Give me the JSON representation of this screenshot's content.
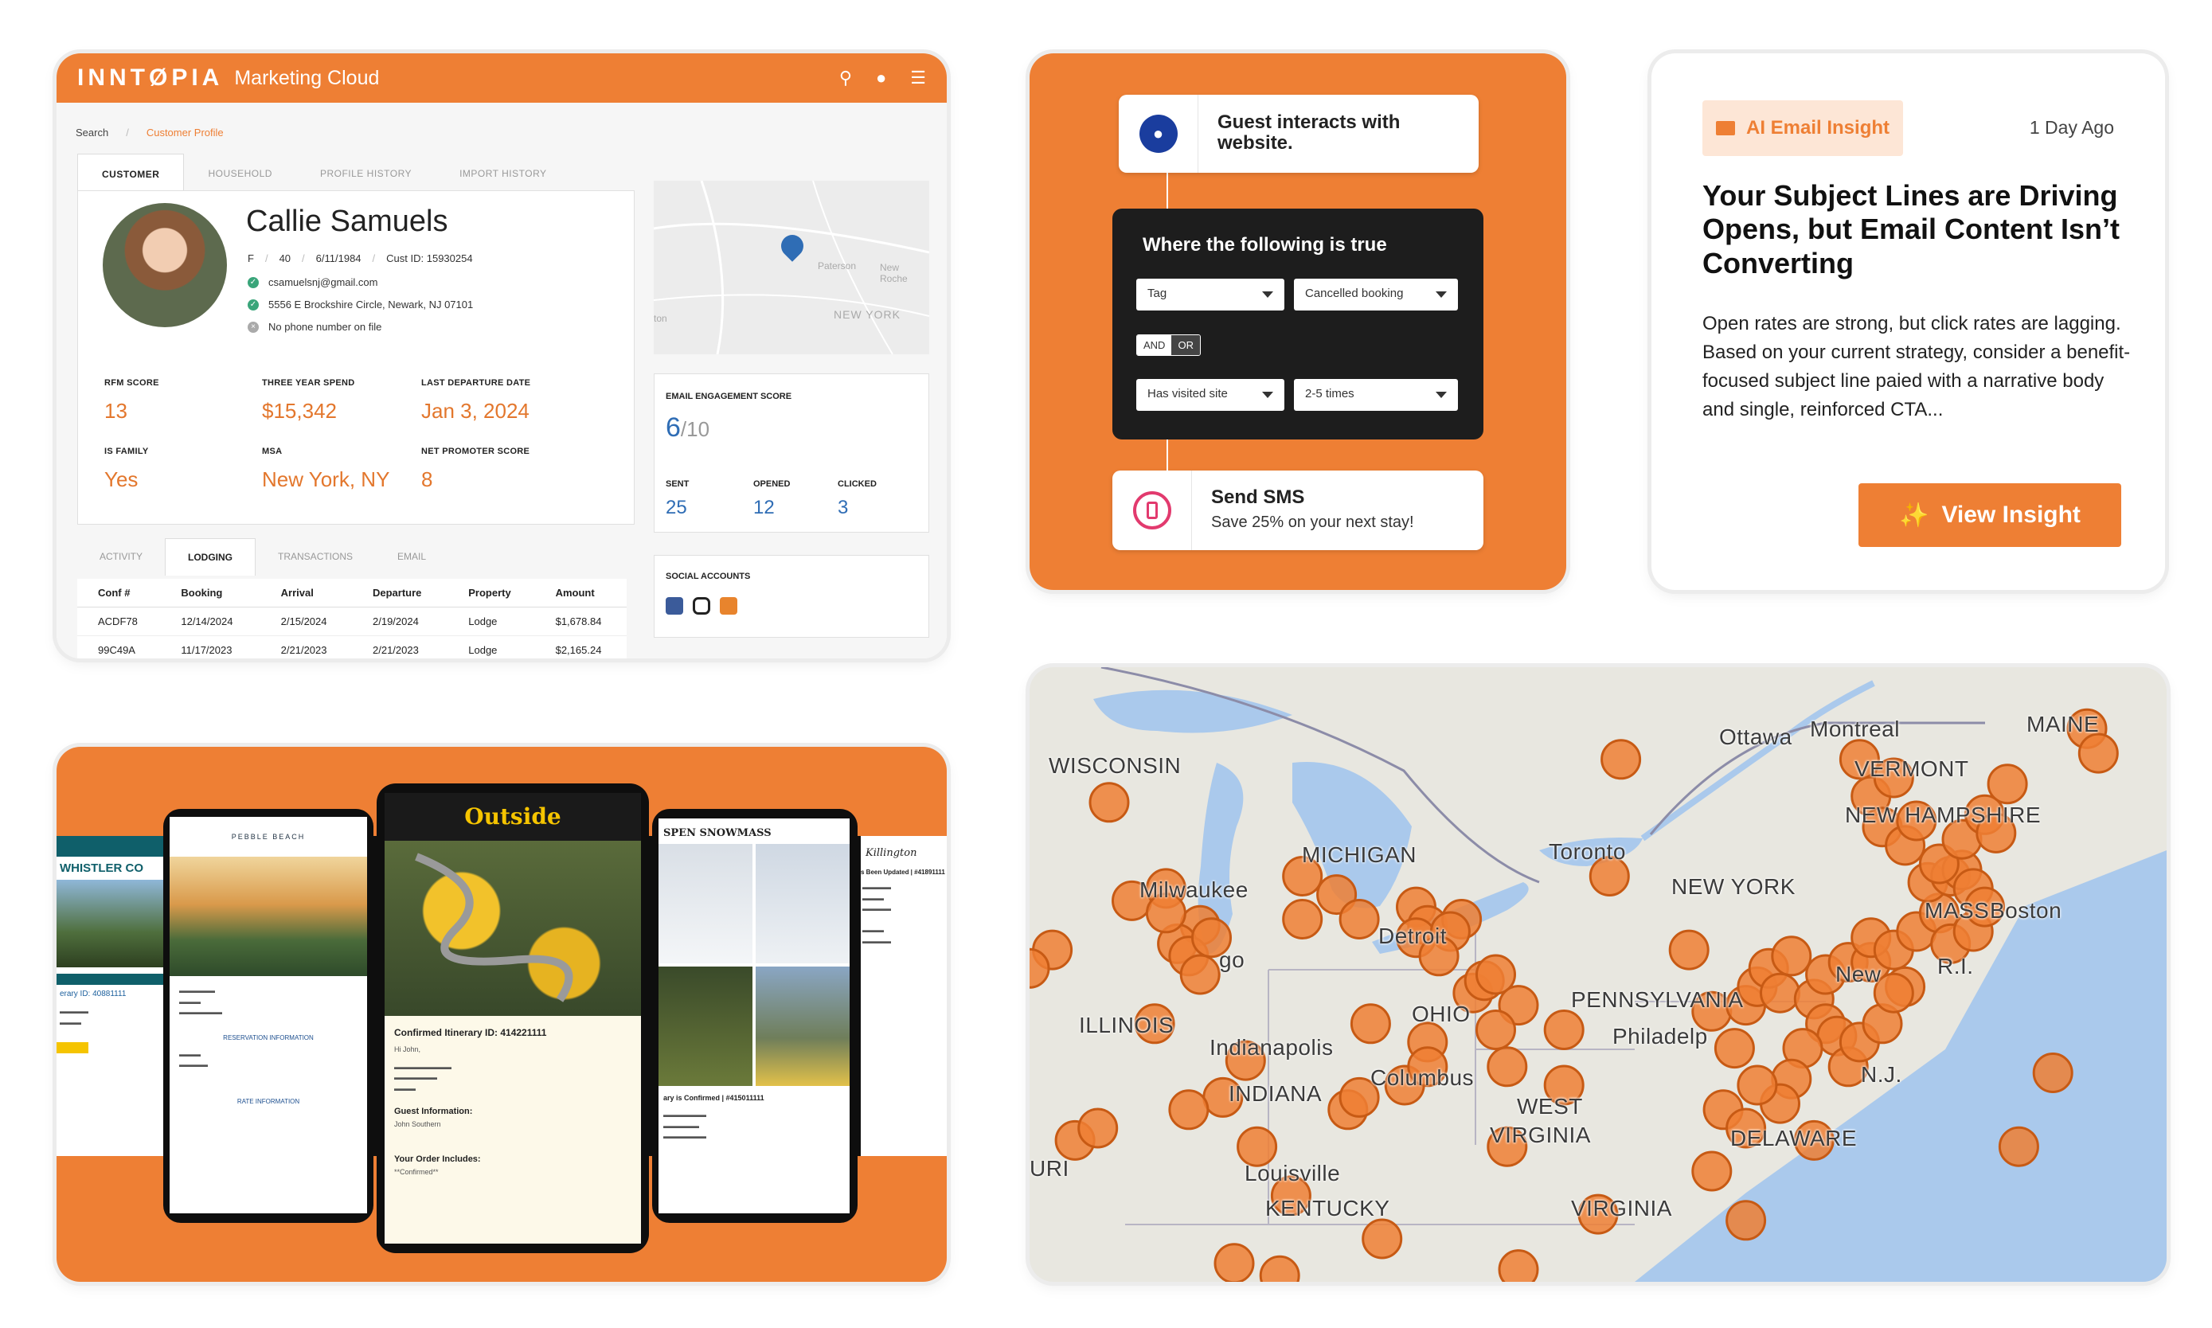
{
  "crm": {
    "brand": "INNTØPIA",
    "app_name": "Marketing Cloud",
    "icons": [
      "search-icon",
      "user-icon",
      "menu-icon"
    ],
    "breadcrumb": [
      "Search",
      "Customer Profile"
    ],
    "tabs": [
      "CUSTOMER",
      "HOUSEHOLD",
      "PROFILE HISTORY",
      "IMPORT HISTORY"
    ],
    "customer": {
      "name": "Callie Samuels",
      "gender": "F",
      "age": "40",
      "dob": "6/11/1984",
      "cust_id": "Cust ID: 15930254",
      "email": "csamuelsnj@gmail.com",
      "address": "5556 E Brockshire Circle, Newark, NJ 07101",
      "phone": "No phone number on file"
    },
    "stats": [
      {
        "label": "RFM SCORE",
        "value": "13"
      },
      {
        "label": "THREE YEAR SPEND",
        "value": "$15,342"
      },
      {
        "label": "LAST DEPARTURE DATE",
        "value": "Jan 3, 2024"
      },
      {
        "label": "IS FAMILY",
        "value": "Yes"
      },
      {
        "label": "MSA",
        "value": "New York, NY"
      },
      {
        "label": "NET PROMOTER SCORE",
        "value": "8"
      }
    ],
    "map_labels": [
      "Paterson",
      "New Roche",
      "NEW YORK",
      "ton"
    ],
    "engagement": {
      "label": "EMAIL ENGAGEMENT SCORE",
      "score": "6",
      "out_of": "/10",
      "sent_label": "SENT",
      "sent": "25",
      "opened_label": "OPENED",
      "opened": "12",
      "clicked_label": "CLICKED",
      "clicked": "3"
    },
    "social_label": "SOCIAL ACCOUNTS",
    "social_icons": [
      "facebook-icon",
      "instagram-icon",
      "youtube-icon"
    ],
    "bottom_tabs": [
      "ACTIVITY",
      "LODGING",
      "TRANSACTIONS",
      "EMAIL"
    ],
    "table": {
      "headers": [
        "Conf #",
        "Booking",
        "Arrival",
        "Departure",
        "Property",
        "Amount"
      ],
      "rows": [
        [
          "ACDF78",
          "12/14/2024",
          "2/15/2024",
          "2/19/2024",
          "Lodge",
          "$1,678.84"
        ],
        [
          "99C49A",
          "11/17/2023",
          "2/21/2023",
          "2/21/2023",
          "Lodge",
          "$2,165.24"
        ]
      ]
    }
  },
  "flow": {
    "trigger": "Guest interacts with website.",
    "condition_title": "Where the following is true",
    "row1": [
      "Tag",
      "Cancelled booking"
    ],
    "logic": [
      "AND",
      "OR"
    ],
    "row2": [
      "Has visited site",
      "2-5 times"
    ],
    "action_title": "Send SMS",
    "action_sub": "Save 25% on your next stay!",
    "colors": {
      "accent": "#ee7f34",
      "dark": "#1d1d1d",
      "user_icon_bg": "#1a3d9e",
      "sms_icon_bg": "#e23a6e"
    }
  },
  "insight": {
    "chip": "AI Email Insight",
    "ago": "1 Day Ago",
    "headline": "Your Subject Lines are Driving Opens, but Email Content Isn’t Converting",
    "body": "Open rates are strong, but click rates are lagging. Based on your current strategy, consider a benefit-focused subject line paied with a narrative body and single, reinforced CTA...",
    "button": "View Insight",
    "button_icon": "sparkle-icon",
    "chip_icon": "envelope-icon"
  },
  "emails": {
    "whistler": {
      "brand": "WHISTLER CO",
      "itinerary": "erary ID: 40881111"
    },
    "pebble": {
      "brand": "PEBBLE BEACH",
      "section1": "RESERVATION INFORMATION",
      "section2": "RATE INFORMATION"
    },
    "outside": {
      "brand": "Outside",
      "title": "Confirmed Itinerary ID: 414221111",
      "greeting": "Hi John,",
      "guest_label": "Guest Information:",
      "guest_name": "John Southern",
      "order_label": "Your Order Includes:",
      "order_line": "**Confirmed**"
    },
    "aspen": {
      "brand": "SPEN SNOWMASS",
      "confirm": "ary is Confirmed | #415011111"
    },
    "killington": {
      "brand": "Killington",
      "updated": "s Been Updated | #41891111"
    }
  },
  "map": {
    "labels": [
      "WISCONSIN",
      "MICHIGAN",
      "Milwaukee",
      "go",
      "ILLINOIS",
      "Indianapolis",
      "INDIANA",
      "OHIO",
      "Columbus",
      "Detroit",
      "Toronto",
      "Ottawa",
      "Montreal",
      "MAINE",
      "VERMONT",
      "NEW HAMPSHIRE",
      "NEW YORK",
      "MASS",
      "Boston",
      "New",
      "PENNSYLVANIA",
      "Philadelp",
      "N.J.",
      "R.I.",
      "DELAWARE",
      "WEST",
      "VIRGINIA",
      "Louisville",
      "KENTUCKY",
      "VIRGINIA",
      "URI"
    ],
    "marker_color": "#ee7f34",
    "points": [
      [
        0.07,
        0.22
      ],
      [
        0.09,
        0.38
      ],
      [
        0.12,
        0.36
      ],
      [
        0.15,
        0.42
      ],
      [
        0.13,
        0.45
      ],
      [
        0.14,
        0.47
      ],
      [
        0.16,
        0.44
      ],
      [
        0.15,
        0.5
      ],
      [
        0.12,
        0.4
      ],
      [
        0.11,
        0.58
      ],
      [
        0.02,
        0.46
      ],
      [
        0.0,
        0.49
      ],
      [
        0.19,
        0.64
      ],
      [
        0.17,
        0.7
      ],
      [
        0.14,
        0.72
      ],
      [
        0.2,
        0.78
      ],
      [
        0.04,
        0.77
      ],
      [
        0.06,
        0.75
      ],
      [
        0.24,
        0.34
      ],
      [
        0.27,
        0.37
      ],
      [
        0.24,
        0.41
      ],
      [
        0.29,
        0.41
      ],
      [
        0.3,
        0.58
      ],
      [
        0.33,
        0.68
      ],
      [
        0.28,
        0.72
      ],
      [
        0.29,
        0.7
      ],
      [
        0.23,
        0.86
      ],
      [
        0.18,
        0.97
      ],
      [
        0.22,
        0.99
      ],
      [
        0.31,
        0.93
      ],
      [
        0.34,
        0.39
      ],
      [
        0.35,
        0.42
      ],
      [
        0.34,
        0.44
      ],
      [
        0.38,
        0.41
      ],
      [
        0.37,
        0.43
      ],
      [
        0.36,
        0.47
      ],
      [
        0.39,
        0.53
      ],
      [
        0.4,
        0.51
      ],
      [
        0.41,
        0.5
      ],
      [
        0.43,
        0.55
      ],
      [
        0.41,
        0.59
      ],
      [
        0.35,
        0.61
      ],
      [
        0.35,
        0.65
      ],
      [
        0.42,
        0.65
      ],
      [
        0.47,
        0.59
      ],
      [
        0.47,
        0.68
      ],
      [
        0.42,
        0.78
      ],
      [
        0.5,
        0.89
      ],
      [
        0.43,
        0.98
      ],
      [
        0.51,
        0.34
      ],
      [
        0.52,
        0.15
      ],
      [
        0.58,
        0.46
      ],
      [
        0.6,
        0.56
      ],
      [
        0.62,
        0.62
      ],
      [
        0.63,
        0.55
      ],
      [
        0.64,
        0.52
      ],
      [
        0.65,
        0.49
      ],
      [
        0.66,
        0.53
      ],
      [
        0.67,
        0.47
      ],
      [
        0.69,
        0.54
      ],
      [
        0.7,
        0.5
      ],
      [
        0.72,
        0.48
      ],
      [
        0.74,
        0.48
      ],
      [
        0.74,
        0.44
      ],
      [
        0.76,
        0.46
      ],
      [
        0.78,
        0.43
      ],
      [
        0.8,
        0.4
      ],
      [
        0.79,
        0.35
      ],
      [
        0.81,
        0.34
      ],
      [
        0.82,
        0.33
      ],
      [
        0.77,
        0.52
      ],
      [
        0.7,
        0.58
      ],
      [
        0.71,
        0.6
      ],
      [
        0.68,
        0.62
      ],
      [
        0.67,
        0.67
      ],
      [
        0.66,
        0.71
      ],
      [
        0.64,
        0.68
      ],
      [
        0.61,
        0.72
      ],
      [
        0.63,
        0.75
      ],
      [
        0.6,
        0.82
      ],
      [
        0.63,
        0.9
      ],
      [
        0.69,
        0.77
      ],
      [
        0.72,
        0.65
      ],
      [
        0.73,
        0.61
      ],
      [
        0.75,
        0.58
      ],
      [
        0.76,
        0.53
      ],
      [
        0.73,
        0.15
      ],
      [
        0.74,
        0.21
      ],
      [
        0.76,
        0.18
      ],
      [
        0.75,
        0.26
      ],
      [
        0.77,
        0.29
      ],
      [
        0.78,
        0.25
      ],
      [
        0.8,
        0.32
      ],
      [
        0.82,
        0.28
      ],
      [
        0.84,
        0.24
      ],
      [
        0.86,
        0.19
      ],
      [
        0.85,
        0.27
      ],
      [
        0.83,
        0.36
      ],
      [
        0.81,
        0.45
      ],
      [
        0.83,
        0.43
      ],
      [
        0.84,
        0.39
      ],
      [
        0.93,
        0.1
      ],
      [
        0.94,
        0.14
      ],
      [
        0.9,
        0.66
      ],
      [
        0.87,
        0.78
      ]
    ]
  }
}
